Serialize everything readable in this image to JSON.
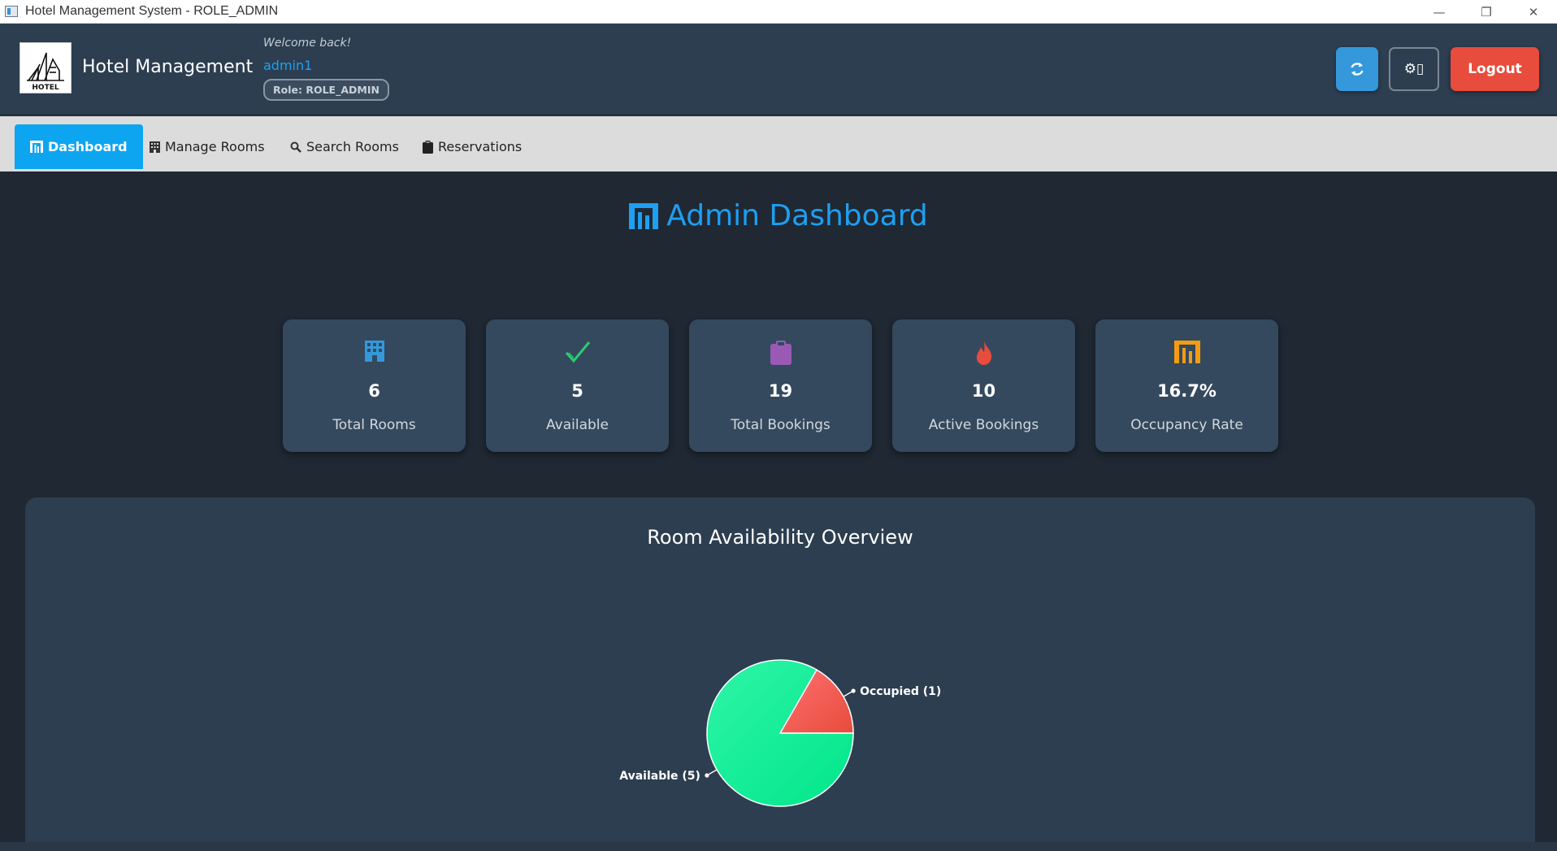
{
  "window": {
    "title": "Hotel Management System - ROLE_ADMIN",
    "minimize": "—",
    "restore": "❐",
    "close": "✕"
  },
  "header": {
    "logo_text": "HOTEL",
    "app_title": "Hotel Management",
    "welcome": "Welcome back!",
    "username": "admin1",
    "role": "Role: ROLE_ADMIN",
    "refresh_icon": "refresh-icon",
    "settings_label": "⚙▯",
    "logout_label": "Logout"
  },
  "tabs": [
    {
      "label": "Dashboard",
      "icon": "bar-chart-icon",
      "active": true
    },
    {
      "label": "Manage Rooms",
      "icon": "building-icon",
      "active": false
    },
    {
      "label": "Search Rooms",
      "icon": "search-icon",
      "active": false
    },
    {
      "label": "Reservations",
      "icon": "clipboard-icon",
      "active": false
    }
  ],
  "dashboard": {
    "title": "Admin Dashboard",
    "cards": [
      {
        "icon": "building-icon",
        "value": "6",
        "label": "Total Rooms",
        "color": "#3498db"
      },
      {
        "icon": "check-icon",
        "value": "5",
        "label": "Available",
        "color": "#2ecc71"
      },
      {
        "icon": "clipboard-icon",
        "value": "19",
        "label": "Total Bookings",
        "color": "#9b59b6"
      },
      {
        "icon": "fire-icon",
        "value": "10",
        "label": "Active Bookings",
        "color": "#e74c3c"
      },
      {
        "icon": "bar-chart-icon",
        "value": "16.7%",
        "label": "Occupancy Rate",
        "color": "#f39c12"
      }
    ],
    "panel_title": "Room Availability Overview"
  },
  "chart_data": {
    "type": "pie",
    "title": "Room Availability Overview",
    "slices": [
      {
        "label": "Occupied (1)",
        "value": 1,
        "color": "#e74c3c"
      },
      {
        "label": "Available (5)",
        "value": 5,
        "color": "#00e68a"
      }
    ]
  },
  "colors": {
    "accent": "#1e9ff2",
    "header_bg": "#2c3e50",
    "page_bg": "#1f2833",
    "logout": "#e74c3c",
    "refresh": "#3498db"
  }
}
